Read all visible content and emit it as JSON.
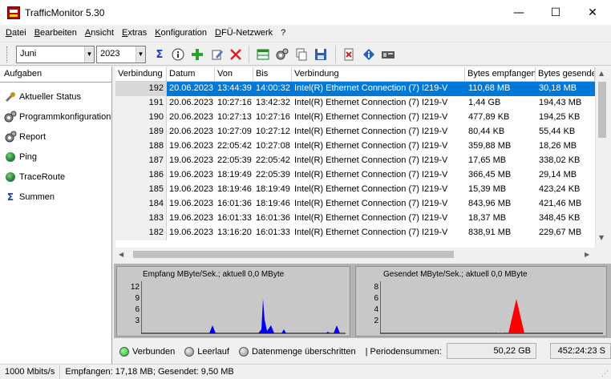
{
  "window": {
    "title": "TrafficMonitor 5.30",
    "minimize": "—",
    "maximize": "☐",
    "close": "✕"
  },
  "menu": [
    {
      "key": "D",
      "rest": "atei"
    },
    {
      "key": "B",
      "rest": "earbeiten"
    },
    {
      "key": "A",
      "rest": "nsicht"
    },
    {
      "key": "E",
      "rest": "xtras"
    },
    {
      "key": "K",
      "rest": "onfiguration"
    },
    {
      "key": "D",
      "rest": "FÜ-Netzwerk"
    },
    {
      "key": "",
      "rest": "?"
    }
  ],
  "toolbar": {
    "month": "Juni",
    "year": "2023",
    "dropdown_arrow": "▼"
  },
  "sidebar": {
    "header": "Aufgaben",
    "items": [
      {
        "label": "Aktueller Status",
        "icon": "wrench-icon"
      },
      {
        "label": "Programmkonfiguration",
        "icon": "gears-icon"
      },
      {
        "label": "Report",
        "icon": "report-icon"
      },
      {
        "label": "Ping",
        "icon": "globe-icon"
      },
      {
        "label": "TraceRoute",
        "icon": "globe-icon"
      },
      {
        "label": "Summen",
        "icon": "sigma-icon"
      }
    ]
  },
  "table": {
    "headers": [
      "Verbindung",
      "Datum",
      "Von",
      "Bis",
      "Verbindung",
      "Bytes empfangen",
      "Bytes gesendet"
    ],
    "rows": [
      [
        "192",
        "20.06.2023",
        "13:44:39",
        "14:00:32",
        "Intel(R) Ethernet Connection (7) I219-V",
        "110,68 MB",
        "30,18 MB"
      ],
      [
        "191",
        "20.06.2023",
        "10:27:16",
        "13:42:32",
        "Intel(R) Ethernet Connection (7) I219-V",
        "1,44 GB",
        "194,43 MB"
      ],
      [
        "190",
        "20.06.2023",
        "10:27:13",
        "10:27:16",
        "Intel(R) Ethernet Connection (7) I219-V",
        "477,89 KB",
        "194,25 KB"
      ],
      [
        "189",
        "20.06.2023",
        "10:27:09",
        "10:27:12",
        "Intel(R) Ethernet Connection (7) I219-V",
        "80,44 KB",
        "55,44 KB"
      ],
      [
        "188",
        "19.06.2023",
        "22:05:42",
        "10:27:08",
        "Intel(R) Ethernet Connection (7) I219-V",
        "359,88 MB",
        "18,26 MB"
      ],
      [
        "187",
        "19.06.2023",
        "22:05:39",
        "22:05:42",
        "Intel(R) Ethernet Connection (7) I219-V",
        "17,65 MB",
        "338,02 KB"
      ],
      [
        "186",
        "19.06.2023",
        "18:19:49",
        "22:05:39",
        "Intel(R) Ethernet Connection (7) I219-V",
        "366,45 MB",
        "29,14 MB"
      ],
      [
        "185",
        "19.06.2023",
        "18:19:46",
        "18:19:49",
        "Intel(R) Ethernet Connection (7) I219-V",
        "15,39 MB",
        "423,24 KB"
      ],
      [
        "184",
        "19.06.2023",
        "16:01:36",
        "18:19:46",
        "Intel(R) Ethernet Connection (7) I219-V",
        "843,96 MB",
        "421,46 MB"
      ],
      [
        "183",
        "19.06.2023",
        "16:01:33",
        "16:01:36",
        "Intel(R) Ethernet Connection (7) I219-V",
        "18,37 MB",
        "348,45 KB"
      ],
      [
        "182",
        "19.06.2023",
        "13:16:20",
        "16:01:33",
        "Intel(R) Ethernet Connection (7) I219-V",
        "838,91 MB",
        "229,67 MB"
      ]
    ]
  },
  "graphs": {
    "receive": {
      "title": "Empfang MByte/Sek.; aktuell 0,0 MByte",
      "ticks": [
        "12",
        "9",
        "6",
        "3"
      ],
      "color": "#0000ff"
    },
    "send": {
      "title": "Gesendet MByte/Sek.; aktuell 0,0 MByte",
      "ticks": [
        "8",
        "6",
        "4",
        "2"
      ],
      "color": "#ff0000"
    }
  },
  "status": {
    "connected": "Verbunden",
    "idle": "Leerlauf",
    "exceeded": "Datenmenge überschritten",
    "period_label": "| Periodensummen:",
    "period_volume": "50,22 GB",
    "period_time": "452:24:23 S"
  },
  "bottom_status": {
    "speed": "1000 Mbits/s",
    "totals": "Empfangen: 17,18 MB; Gesendet: 9,50 MB"
  }
}
